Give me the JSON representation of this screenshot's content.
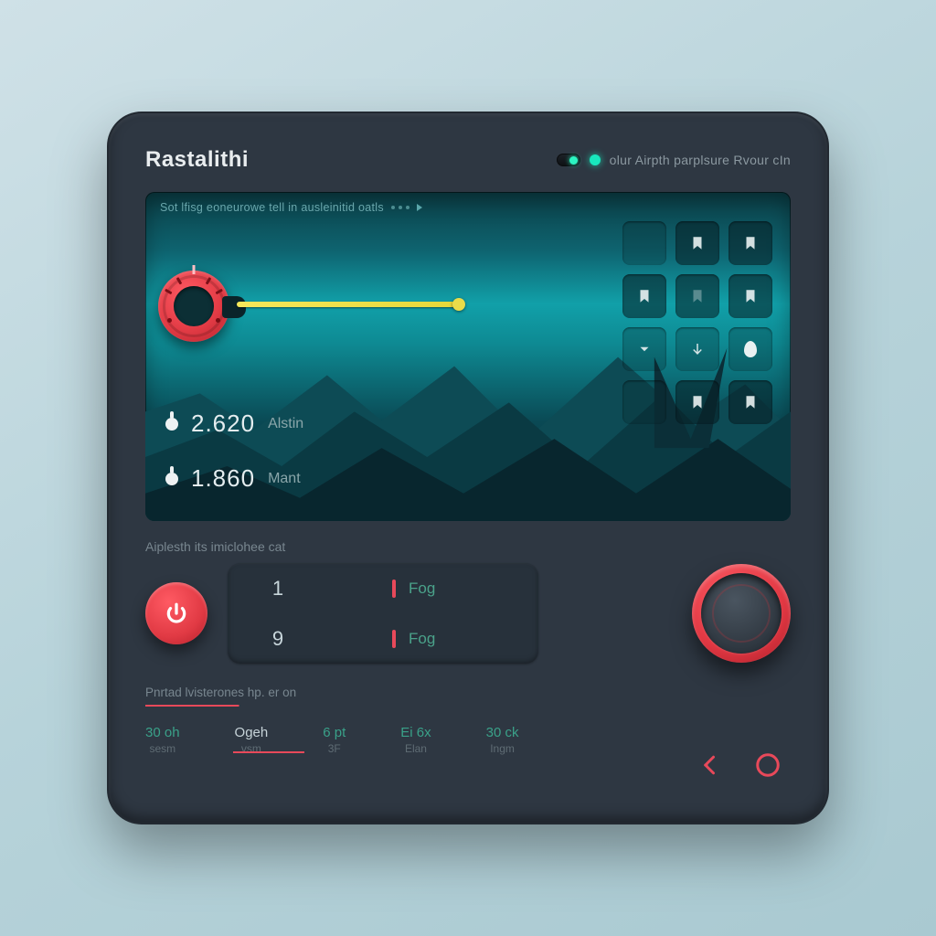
{
  "header": {
    "title": "Rastalithi",
    "status_text": "olur Airpth parplsure Rvour cIn"
  },
  "screen": {
    "caption": "Sot lfisg eoneurowe tell in ausleinitid oatls",
    "readouts": [
      {
        "value": "2.620",
        "label": "Alstin"
      },
      {
        "value": "1.860",
        "label": "Mant"
      }
    ],
    "slider_percent": 62,
    "status_icons": [
      "bookmark",
      "bookmark",
      "bookmark",
      "dim-bookmark",
      "bookmark",
      "chevron-down",
      "down-arrow",
      "drop",
      "bookmark",
      "bookmark"
    ]
  },
  "section1": {
    "label": "Aiplesth its imiclohee cat",
    "rows": [
      {
        "num": "1",
        "label": "Fog"
      },
      {
        "num": "9",
        "label": "Fog"
      }
    ]
  },
  "section2": {
    "label": "Pnrtad lvisterones hp. er on",
    "ticks": [
      {
        "a": "30 oh",
        "b": "sesm"
      },
      {
        "a": "Ogeh",
        "b": "vsm"
      },
      {
        "a": "6 pt",
        "b": "3F"
      },
      {
        "a": "Ei 6x",
        "b": "Elan"
      },
      {
        "a": "30 ck",
        "b": "Ingm"
      }
    ],
    "selected_index": 1
  },
  "colors": {
    "accent_red": "#e8495a",
    "accent_teal": "#18e8bd",
    "accent_green": "#4aa28a"
  }
}
